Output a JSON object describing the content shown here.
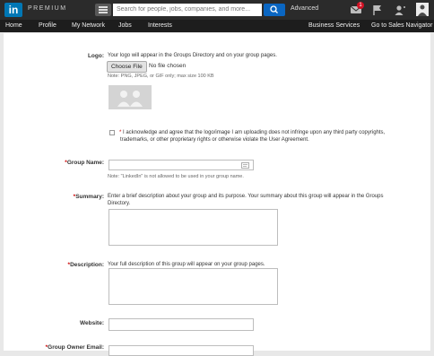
{
  "topbar": {
    "logo_text": "in",
    "premium_label": "PREMIUM",
    "search_placeholder": "Search for people, jobs, companies, and more...",
    "advanced_label": "Advanced",
    "notification_count": "1",
    "brand_color": "#0077b5"
  },
  "nav": {
    "items": [
      "Home",
      "Profile",
      "My Network",
      "Jobs",
      "Interests"
    ],
    "right_items": [
      "Business Services",
      "Go to Sales Navigator"
    ]
  },
  "form": {
    "logo": {
      "label": "Logo:",
      "description": "Your logo will appear in the Groups Directory and on your group pages.",
      "choose_button": "Choose File",
      "no_file": "No file chosen",
      "note": "Note: PNG, JPEG, or GIF only; max size 100 KB"
    },
    "agreement": {
      "asterisk": "*",
      "line1": "I acknowledge and agree that the logo/image I am uploading does not infringe upon any third party copyrights,",
      "line2": "trademarks, or other proprietary rights or otherwise violate the User Agreement."
    },
    "group_name": {
      "asterisk": "*",
      "label": "Group Name:",
      "value": "",
      "note": "Note: \"LinkedIn\" is not allowed to be used in your group name."
    },
    "summary": {
      "asterisk": "*",
      "label": "Summary:",
      "line1": "Enter a brief description about your group and its purpose. Your summary about this group will appear in the Groups",
      "line2": "Directory.",
      "value": ""
    },
    "description": {
      "asterisk": "*",
      "label": "Description:",
      "text": "Your full description of this group will appear on your group pages.",
      "value": ""
    },
    "website": {
      "label": "Website:",
      "value": ""
    },
    "owner_email": {
      "asterisk": "*",
      "label": "Group Owner Email:"
    }
  }
}
